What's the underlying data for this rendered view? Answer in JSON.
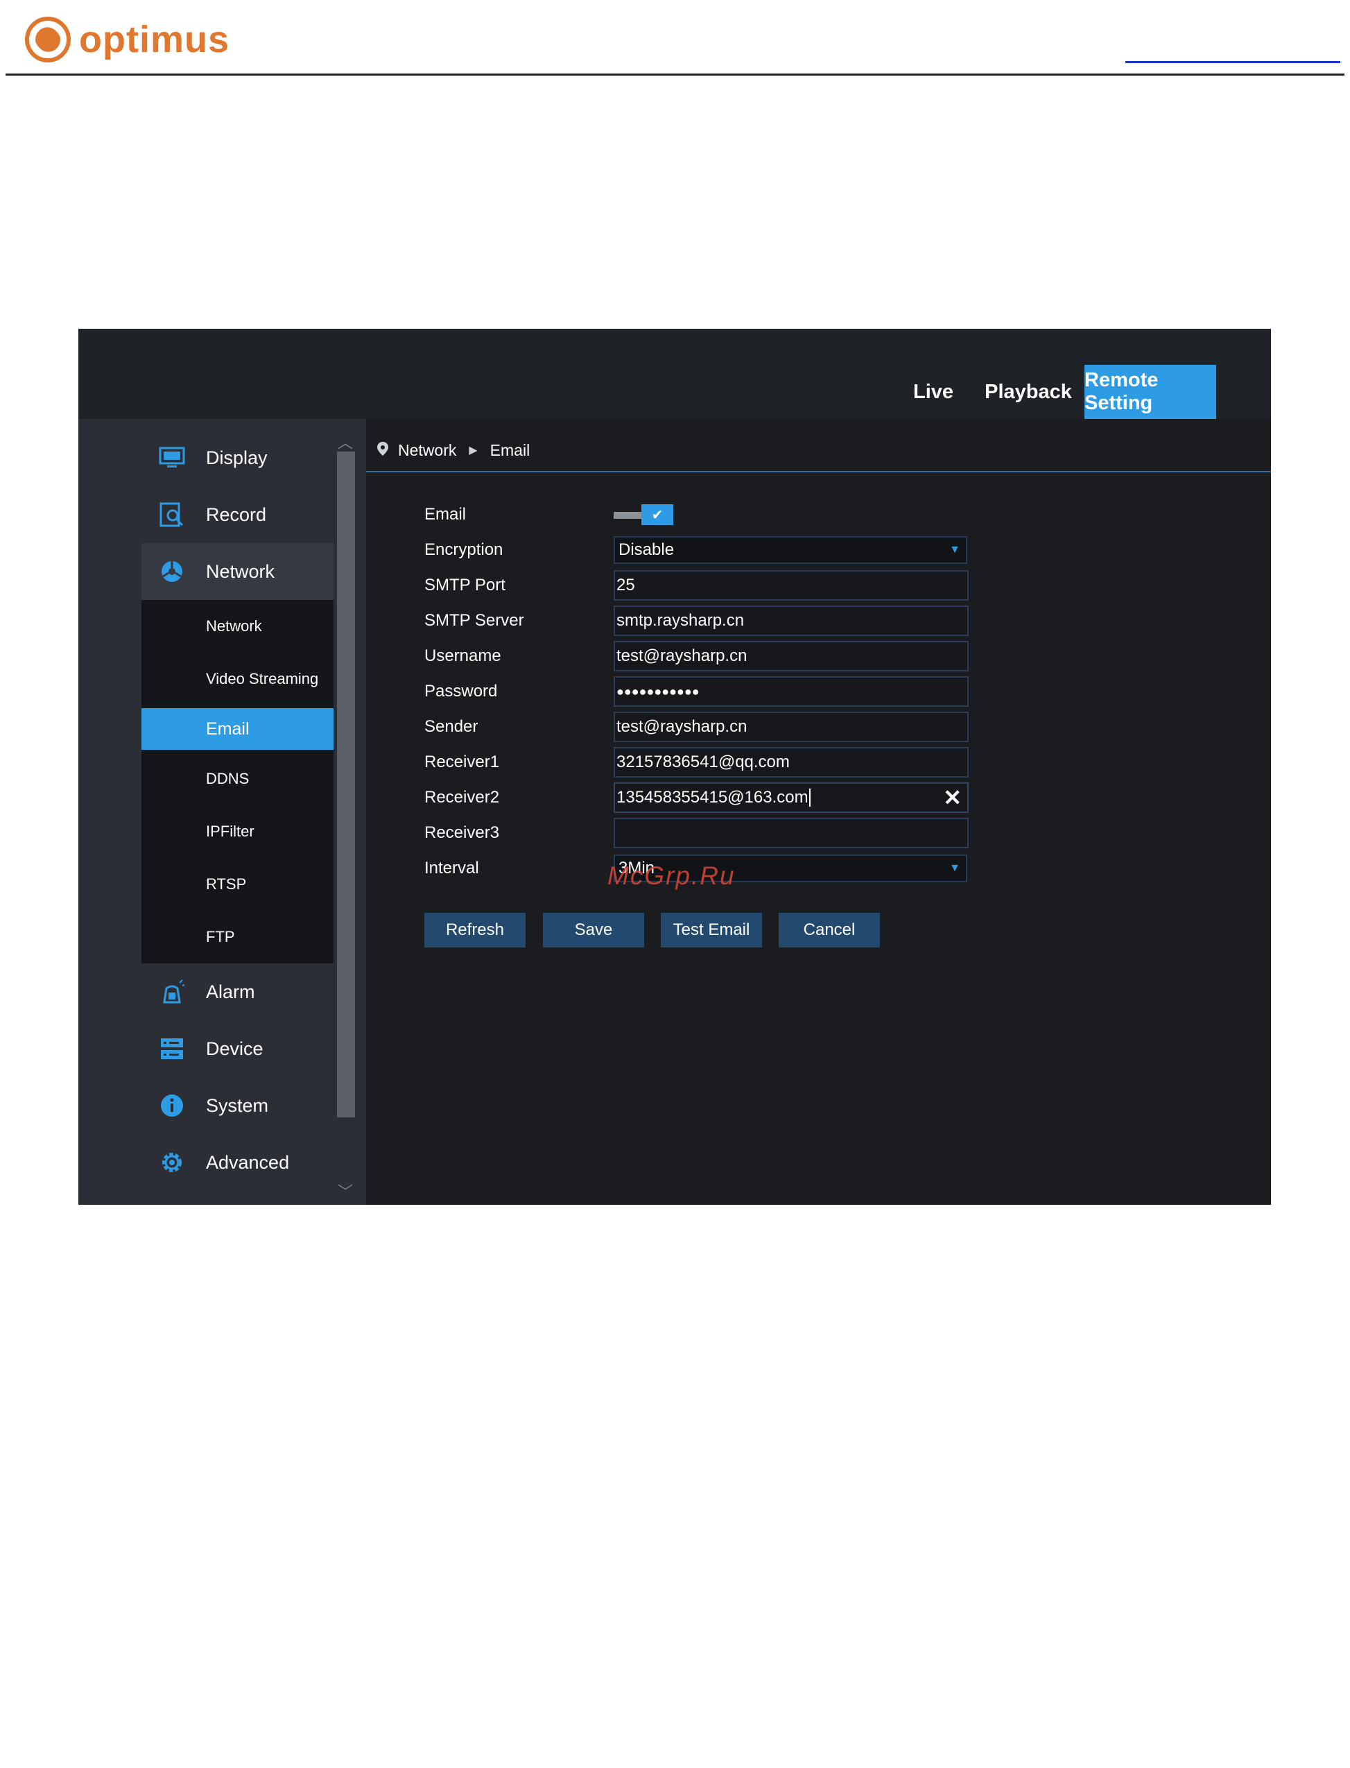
{
  "document": {
    "brand": "optimus",
    "brand_color": "#e0772e"
  },
  "app": {
    "tabs": [
      {
        "label": "Live"
      },
      {
        "label": "Playback"
      },
      {
        "label": "Remote Setting"
      }
    ],
    "accent_color": "#2e9ce4",
    "sidebar": {
      "items": [
        {
          "label": "Display",
          "icon": "monitor-icon"
        },
        {
          "label": "Record",
          "icon": "record-icon"
        },
        {
          "label": "Network",
          "icon": "network-icon"
        },
        {
          "label": "Alarm",
          "icon": "alarm-icon"
        },
        {
          "label": "Device",
          "icon": "device-icon"
        },
        {
          "label": "System",
          "icon": "info-icon"
        },
        {
          "label": "Advanced",
          "icon": "gear-icon"
        }
      ],
      "network_sub": [
        "Network",
        "Video Streaming",
        "Email",
        "DDNS",
        "IPFilter",
        "RTSP",
        "FTP"
      ],
      "selected_sub": "Email"
    },
    "breadcrumb": {
      "level1": "Network",
      "level2": "Email"
    },
    "form": {
      "email_label": "Email",
      "email_enabled": true,
      "encryption_label": "Encryption",
      "encryption_value": "Disable",
      "smtp_port_label": "SMTP Port",
      "smtp_port_value": "25",
      "smtp_server_label": "SMTP Server",
      "smtp_server_value": "smtp.raysharp.cn",
      "username_label": "Username",
      "username_value": "test@raysharp.cn",
      "password_label": "Password",
      "password_value": "●●●●●●●●●●●",
      "sender_label": "Sender",
      "sender_value": "test@raysharp.cn",
      "receiver1_label": "Receiver1",
      "receiver1_value": "32157836541@qq.com",
      "receiver2_label": "Receiver2",
      "receiver2_value": "135458355415@163.com",
      "receiver3_label": "Receiver3",
      "receiver3_value": "",
      "interval_label": "Interval",
      "interval_value": "3Min"
    },
    "buttons": {
      "refresh": "Refresh",
      "save": "Save",
      "test_email": "Test Email",
      "cancel": "Cancel"
    }
  },
  "watermark": "McGrp.Ru"
}
